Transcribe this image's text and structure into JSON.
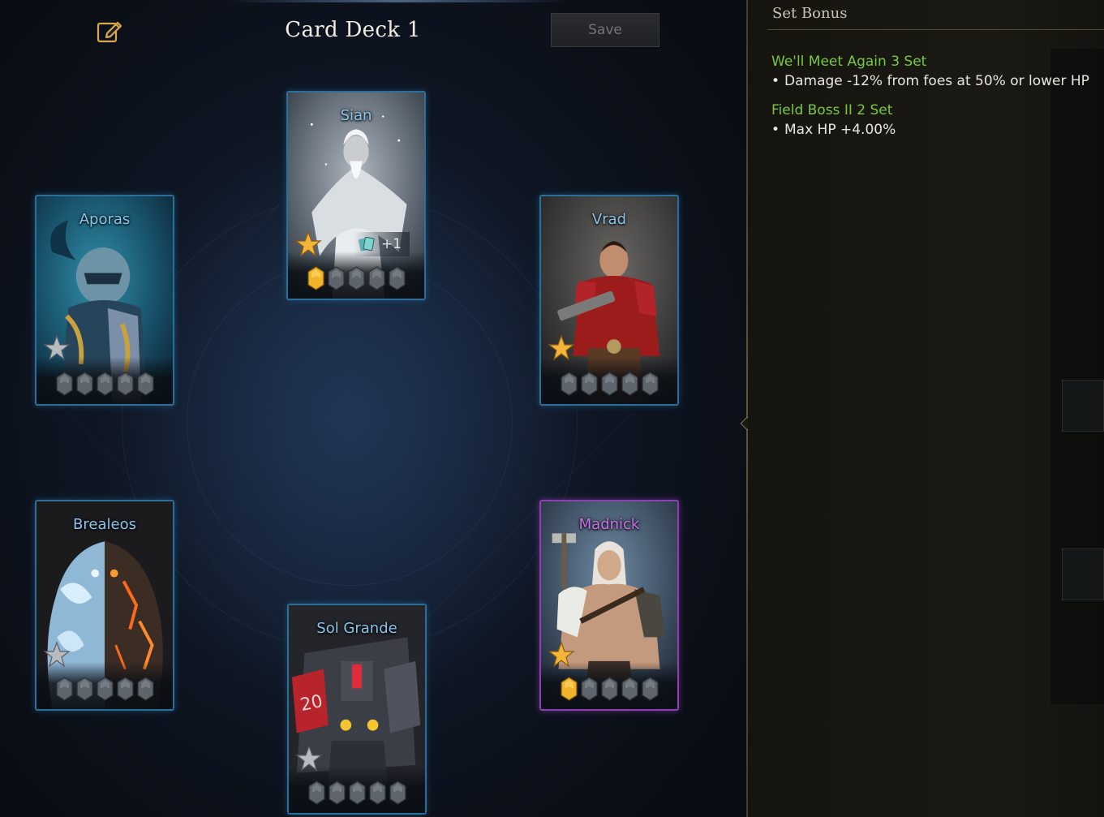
{
  "deck": {
    "title": "Card Deck 1",
    "save_label": "Save"
  },
  "cards": [
    {
      "name": "Sian",
      "grade": "rare",
      "star": "gold",
      "awakened": 1,
      "total_gems": 5,
      "extra_count": "+1"
    },
    {
      "name": "Aporas",
      "grade": "rare",
      "star": "silver",
      "awakened": 0,
      "total_gems": 5
    },
    {
      "name": "Vrad",
      "grade": "rare",
      "star": "gold",
      "awakened": 0,
      "total_gems": 5
    },
    {
      "name": "Brealeos",
      "grade": "rare",
      "star": "silver",
      "awakened": 0,
      "total_gems": 5
    },
    {
      "name": "Madnick",
      "grade": "epic",
      "star": "gold",
      "awakened": 1,
      "total_gems": 5
    },
    {
      "name": "Sol Grande",
      "grade": "rare",
      "star": "silver",
      "awakened": 0,
      "total_gems": 5
    }
  ],
  "set_bonus": {
    "title": "Set Bonus",
    "items": [
      {
        "name": "We'll Meet Again 3 Set",
        "effect": "Damage -12% from foes at 50% or lower HP"
      },
      {
        "name": "Field Boss II 2 Set",
        "effect": "Max HP +4.00%"
      }
    ]
  },
  "colors": {
    "rare_name": "#8cc4ea",
    "epic_name": "#c774e8",
    "bonus_name": "#7ac93c",
    "gold_gem": "#f0b428",
    "empty_gem": "#5e646b"
  },
  "icons": {
    "edit": "edit-note-icon",
    "star_gold": "gold-star-icon",
    "star_silver": "silver-star-icon",
    "card_stack": "card-stack-icon",
    "gem": "awakening-gem-icon"
  }
}
